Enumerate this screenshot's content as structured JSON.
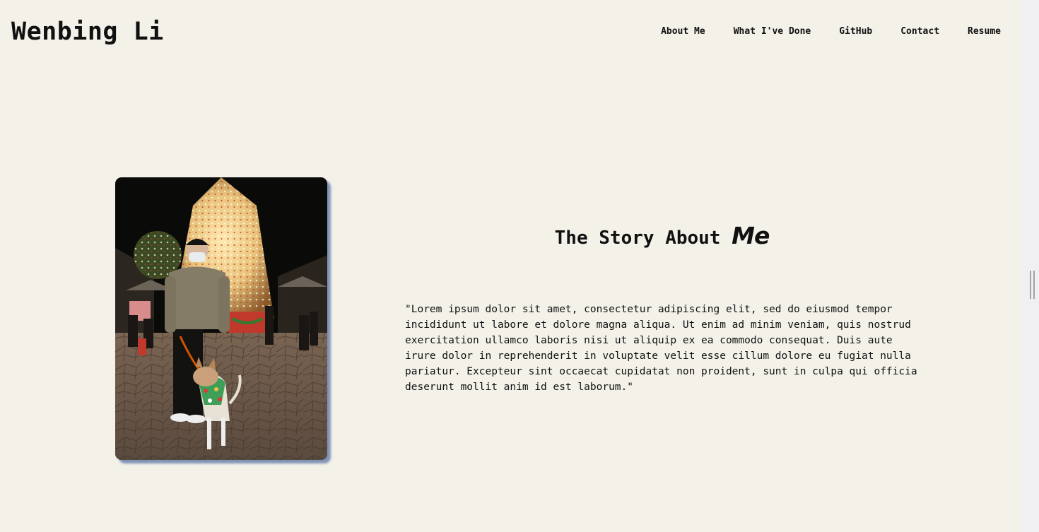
{
  "header": {
    "logo": "Wenbing Li",
    "nav": [
      {
        "label": "About Me"
      },
      {
        "label": "What I've Done"
      },
      {
        "label": "GitHub"
      },
      {
        "label": "Contact"
      },
      {
        "label": "Resume"
      }
    ]
  },
  "about": {
    "title_main": "The Story About ",
    "title_accent": "Me",
    "paragraph": "\"Lorem ipsum dolor sit amet, consectetur adipiscing elit, sed do eiusmod tempor incididunt ut labore et dolore magna aliqua. Ut enim ad minim veniam, quis nostrud exercitation ullamco laboris nisi ut aliquip ex ea commodo consequat. Duis aute irure dolor in reprehenderit in voluptate velit esse cillum dolore eu fugiat nulla pariatur. Excepteur sint occaecat cupidatat non proident, sunt in culpa qui officia deserunt mollit anim id est laborum.\""
  },
  "colors": {
    "background": "#f4f1e9",
    "text": "#111111",
    "photo_shadow": "#7f93b6",
    "scrollbar_track": "#f0f0f2",
    "scrollbar_grip": "#a3a3a6"
  }
}
